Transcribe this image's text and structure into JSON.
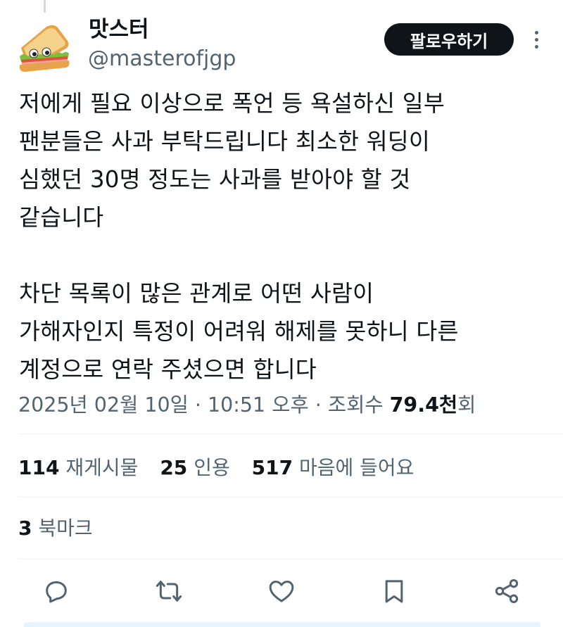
{
  "author": {
    "display_name": "맛스터",
    "handle": "@masterofjgp",
    "avatar_icon": "sandwich-avatar"
  },
  "follow_button": {
    "label": "팔로우하기"
  },
  "more_button": {
    "icon": "more-vertical-icon"
  },
  "tweet": {
    "text": "저에게 필요 이상으로 폭언 등 욕설하신 일부\n팬분들은 사과 부탁드립니다 최소한 워딩이\n심했던 30명 정도는 사과를 받아야 할 것\n같습니다\n\n차단 목록이 많은 관계로 어떤 사람이\n가해자인지 특정이 어려워 해제를 못하니 다른\n계정으로 연락 주셨으면 합니다"
  },
  "meta": {
    "date": "2025년 02월 10일",
    "separator": "·",
    "time": "10:51 오후",
    "views_label": "조회수",
    "views_count": "79.4천",
    "views_suffix": "회"
  },
  "stats": {
    "reposts_count": "114",
    "reposts_label": "재게시물",
    "quotes_count": "25",
    "quotes_label": "인용",
    "likes_count": "517",
    "likes_label": "마음에 들어요",
    "bookmarks_count": "3",
    "bookmarks_label": "북마크"
  },
  "actions": [
    {
      "name": "reply",
      "icon": "reply-icon"
    },
    {
      "name": "repost",
      "icon": "repost-icon"
    },
    {
      "name": "like",
      "icon": "heart-icon"
    },
    {
      "name": "bookmark",
      "icon": "bookmark-icon"
    },
    {
      "name": "share",
      "icon": "share-icon"
    }
  ],
  "colors": {
    "text_primary": "#0f1419",
    "text_secondary": "#536471",
    "divider": "#eff3f4",
    "follow_bg": "#0f1419",
    "follow_text": "#ffffff"
  }
}
